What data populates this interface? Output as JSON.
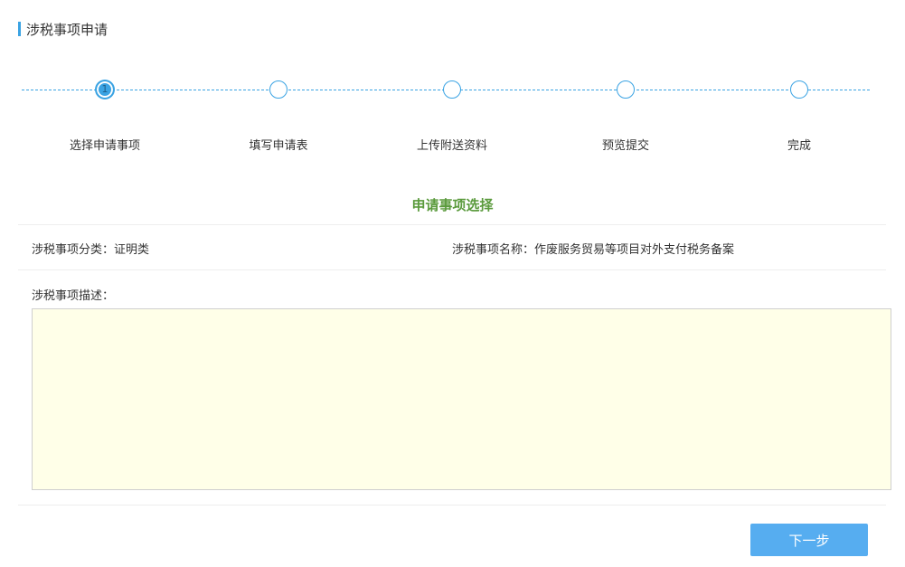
{
  "header": {
    "title": "涉税事项申请"
  },
  "steps": [
    {
      "label": "选择申请事项",
      "number": "1",
      "active": true
    },
    {
      "label": "填写申请表",
      "active": false
    },
    {
      "label": "上传附送资料",
      "active": false
    },
    {
      "label": "预览提交",
      "active": false
    },
    {
      "label": "完成",
      "active": false
    }
  ],
  "section": {
    "title": "申请事项选择"
  },
  "info": {
    "category_label": "涉税事项分类：",
    "category_value": "证明类",
    "name_label": "涉税事项名称：",
    "name_value": "作废服务贸易等项目对外支付税务备案"
  },
  "description": {
    "label": "涉税事项描述：",
    "value": ""
  },
  "actions": {
    "next_label": "下一步"
  },
  "colors": {
    "accent": "#3aa3e3",
    "section_title": "#5a9a3c",
    "desc_background": "#ffffe8",
    "button": "#56adf0"
  }
}
